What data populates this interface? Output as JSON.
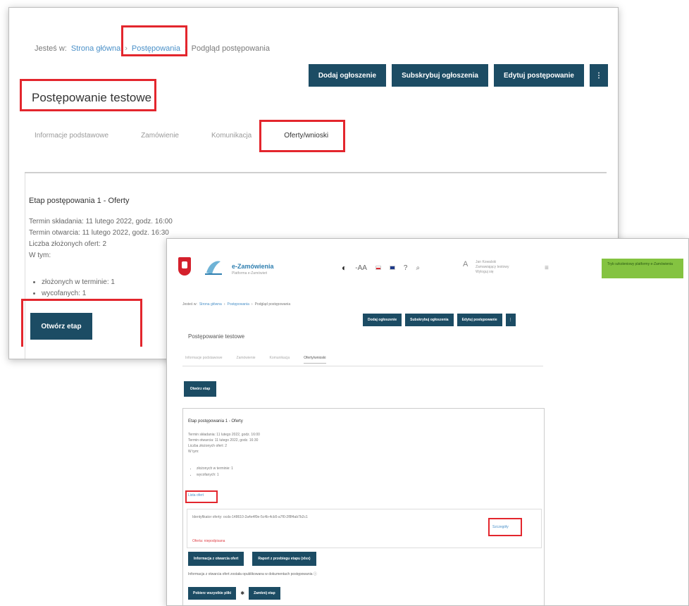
{
  "back": {
    "breadcrumb": [
      "Jesteś w:",
      "Strona główna",
      "Postępowania",
      "Podgląd postępowania"
    ],
    "toolbar": {
      "btn1": "Dodaj ogłoszenie",
      "btn2": "Subskrybuj ogłoszenia",
      "btn3": "Edytuj postępowanie",
      "more": "⋮"
    },
    "title": "Postępowanie testowe",
    "tabs": [
      "Informacje podstawowe",
      "Zamówienie",
      "Komunikacja",
      "Oferty/wnioski"
    ],
    "stage": {
      "title": "Etap postępowania 1 - Oferty",
      "info": [
        "Termin składania: 11 lutego 2022, godz. 16:00",
        "Termin otwarcia: 11 lutego 2022, godz. 16:30",
        "Liczba złożonych ofert: 2",
        "W tym:"
      ],
      "list": [
        "złożonych w terminie: 1",
        "wycofanych: 1"
      ],
      "open_button": "Otwórz etap"
    }
  },
  "front": {
    "logo": {
      "name": "e-Zamówienia",
      "subtitle": "Platforma e-Zamówień"
    },
    "header": {
      "contrast": "◐",
      "font_size": "-AA",
      "lang_pl": "PL",
      "lang_en": "EN",
      "help": "?",
      "search": "⌕",
      "user_icon": "A",
      "user_lines": [
        "Jan Kowalski",
        "Zamawiający testowy",
        "Wyloguj się"
      ],
      "menu": "≡",
      "notice": "Tryb szkoleniowy platformy e-Zamówienia"
    },
    "breadcrumb": [
      "Jesteś w:",
      "Strona główna",
      "Postępowania",
      "Podgląd postępowania"
    ],
    "toolbar": {
      "btn1": "Dodaj ogłoszenie",
      "btn2": "Subskrybuj ogłoszenia",
      "btn3": "Edytuj postępowanie",
      "more": "⋮"
    },
    "title": "Postępowanie testowe",
    "tabs": [
      "Informacje podstawowe",
      "Zamówienie",
      "Komunikacja",
      "Oferty/wnioski"
    ],
    "open_button": "Otwórz etap",
    "stage": {
      "title": "Etap postępowania 1 - Oferty",
      "info": [
        "Termin składania: 11 lutego 2022, godz. 16:00",
        "Termin otwarcia: 11 lutego 2022, godz. 16:30",
        "Liczba złożonych ofert: 2",
        "W tym:"
      ],
      "list": [
        "złożonych w terminie: 1",
        "wycofanych: 1"
      ],
      "link": "Lista ofert",
      "sub_text": "Identyfikator oferty: ocds-148610-2a4e4f0e-5c4b-4cb5-a7f0-2f8f4ab7b2c1",
      "sub_link": "Szczegóły",
      "sub_red": "Oferta: niepodpisana",
      "row_btn1": "Informacja z otwarcia ofert",
      "row_btn2": "Raport z przebiegu etapu (xlsx)",
      "note": "Informacja z otwarcia ofert została opublikowana w dokumentach postępowania",
      "note_icon": "ⓘ",
      "bottom_btn1": "Pobierz wszystkie pliki",
      "star": "✱",
      "bottom_btn2": "Zamknij etap"
    }
  },
  "colors": {
    "button": "#1c4c64",
    "highlight": "#e3262d",
    "link": "#4a90c8",
    "notice": "#84c341"
  }
}
